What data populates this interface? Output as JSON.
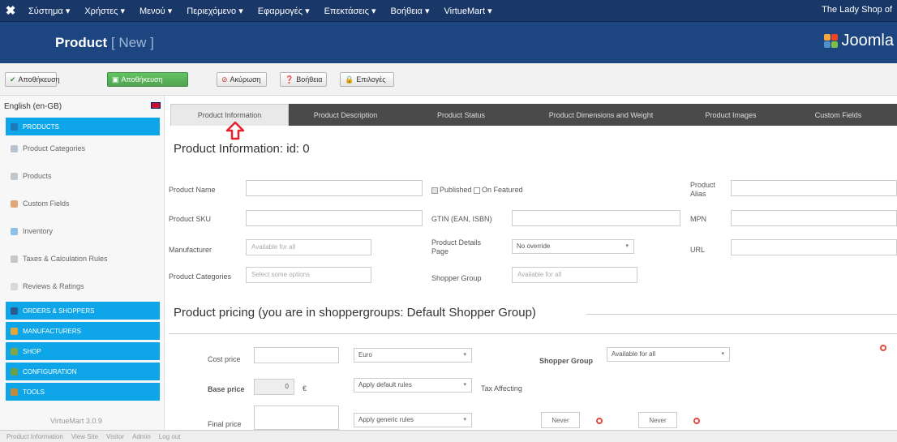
{
  "topbar": {
    "menu": [
      "Σύστημα ▾",
      "Χρήστες ▾",
      "Μενού ▾",
      "Περιεχόμενο ▾",
      "Εφαρμογές ▾",
      "Επεκτάσεις ▾",
      "Βοήθεια ▾",
      "VirtueMart ▾"
    ],
    "site_name": "The Lady Shop of"
  },
  "titlebar": {
    "title": "Product",
    "subtitle": "[ New ]",
    "logo_text": "Joomla"
  },
  "toolbar": {
    "buttons": [
      {
        "label": "Αποθήκευση",
        "icon": "check-icon"
      },
      {
        "label": "Αποθήκευση",
        "icon": "save-icon"
      },
      {
        "label": "Ακύρωση",
        "icon": "cancel-icon"
      },
      {
        "label": "Βοήθεια",
        "icon": "help-icon"
      },
      {
        "label": "Επιλογές",
        "icon": "lock-icon"
      }
    ]
  },
  "sidebar": {
    "language": "English (en-GB)",
    "items": [
      {
        "label": "PRODUCTS",
        "highlight": true,
        "icon_color": "#1b7bb5"
      },
      {
        "label": "Product Categories",
        "highlight": false,
        "icon_color": "#b9c3cf"
      },
      {
        "label": "Products",
        "highlight": false,
        "icon_color": "#c1c7ce"
      },
      {
        "label": "Custom Fields",
        "highlight": false,
        "icon_color": "#e0a878"
      },
      {
        "label": "Inventory",
        "highlight": false,
        "icon_color": "#8fc0e6"
      },
      {
        "label": "Taxes & Calculation Rules",
        "highlight": false,
        "icon_color": "#c7c7c7"
      },
      {
        "label": "Reviews & Ratings",
        "highlight": false,
        "icon_color": "#d8d8d8"
      },
      {
        "label": "ORDERS & SHOPPERS",
        "highlight": true,
        "icon_color": "#2b5a8f"
      },
      {
        "label": "MANUFACTURERS",
        "highlight": true,
        "icon_color": "#e0a83a"
      },
      {
        "label": "SHOP",
        "highlight": true,
        "icon_color": "#7fa64a"
      },
      {
        "label": "CONFIGURATION",
        "highlight": true,
        "icon_color": "#6aa04a"
      },
      {
        "label": "TOOLS",
        "highlight": true,
        "icon_color": "#c28a3a"
      }
    ],
    "version": "VirtueMart 3.0.9"
  },
  "tabs": [
    "Product Information",
    "Product Description",
    "Product Status",
    "Product Dimensions and Weight",
    "Product Images",
    "Custom Fields"
  ],
  "main": {
    "heading": "Product Information: id: 0",
    "fields": {
      "product_name_label": "Product Name",
      "published_label": "Published",
      "featured_label": "On Featured",
      "product_alias_label": "Product Alias",
      "product_sku_label": "Product SKU",
      "gtin_label": "GTIN (EAN, ISBN)",
      "mpn_label": "MPN",
      "manufacturer_label": "Manufacturer",
      "manufacturer_placeholder": "Available for all",
      "details_page_label": "Product Details Page",
      "details_page_value": "No override",
      "url_label": "URL",
      "categories_label": "Product Categories",
      "categories_placeholder": "Select some options",
      "shopper_group_label": "Shopper Group",
      "shopper_group_placeholder": "Available for all"
    },
    "pricing_heading": "Product pricing (you are in shoppergroups: Default Shopper Group)",
    "pricing": {
      "cost_price_label": "Cost price",
      "currency": "Euro",
      "shopper_group_label": "Shopper Group",
      "shopper_group_value": "Available for all",
      "base_price_label": "Base price",
      "base_price_value": "0",
      "base_price_symbol": "€",
      "tax_rule_value": "Apply default rules",
      "tax_affecting_label": "Tax Affecting",
      "final_price_label": "Final price",
      "discount_rule_value": "Apply generic rules",
      "never1": "Never",
      "never2": "Never"
    }
  },
  "statusbar": {
    "items": [
      "Product Information",
      "View Site",
      "Visitor",
      "Admin",
      "Log out"
    ]
  },
  "colors": {
    "topbar": "#1a3867",
    "titlebar": "#1d4680",
    "sidebar_highlight": "#0ea6e8",
    "tab_bar": "#4a4a4a",
    "save_green": "#51a351",
    "arrow_red": "#e8202a"
  }
}
